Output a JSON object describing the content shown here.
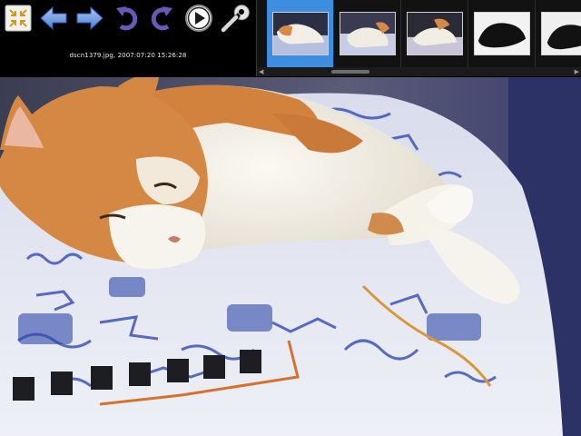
{
  "toolbar": {
    "buttons": [
      {
        "name": "fit-window-button",
        "icon": "fit-window-icon"
      },
      {
        "name": "previous-button",
        "icon": "arrow-left-icon"
      },
      {
        "name": "next-button",
        "icon": "arrow-right-icon"
      },
      {
        "name": "rotate-left-button",
        "icon": "rotate-ccw-icon"
      },
      {
        "name": "rotate-right-button",
        "icon": "rotate-cw-icon"
      },
      {
        "name": "slideshow-button",
        "icon": "play-icon"
      },
      {
        "name": "settings-button",
        "icon": "wrench-icon"
      }
    ],
    "caption": "dscn1379.jpg, 2007:07:20 15:26:28"
  },
  "filmstrip": {
    "selected_index": 0,
    "thumbnails": [
      {
        "subject": "orange-white cat on blanket"
      },
      {
        "subject": "orange-white cat on blanket"
      },
      {
        "subject": "orange-white cat on blanket"
      },
      {
        "subject": "black cat on white sheet"
      },
      {
        "subject": "black cat on white sheet"
      }
    ]
  },
  "colors": {
    "selection": "#3d8ee0",
    "arrow_blue": "#6f9ee8",
    "rotate_purple": "#6a58b8"
  }
}
